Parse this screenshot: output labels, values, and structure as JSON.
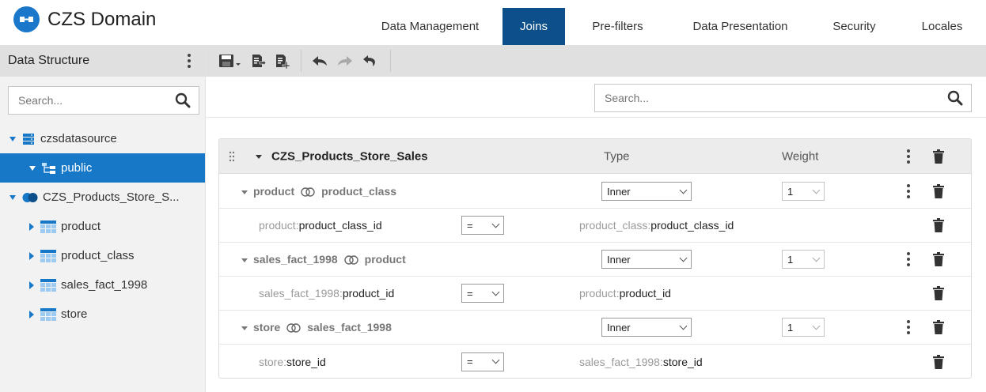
{
  "app": {
    "title": "CZS Domain"
  },
  "tabs": [
    {
      "label": "Data Management",
      "active": false
    },
    {
      "label": "Joins",
      "active": true
    },
    {
      "label": "Pre-filters",
      "active": false
    },
    {
      "label": "Data Presentation",
      "active": false
    },
    {
      "label": "Security",
      "active": false
    },
    {
      "label": "Locales",
      "active": false
    }
  ],
  "sidebar": {
    "title": "Data Structure",
    "search_placeholder": "Search...",
    "tree": [
      {
        "label": "czsdatasource",
        "icon": "server-icon",
        "expanded": true
      },
      {
        "label": "public",
        "icon": "schema-icon",
        "expanded": true,
        "selected": true
      },
      {
        "label": "CZS_Products_Store_S...",
        "icon": "join-icon",
        "expanded": true
      },
      {
        "label": "product",
        "icon": "table-icon",
        "expanded": false
      },
      {
        "label": "product_class",
        "icon": "table-icon",
        "expanded": false
      },
      {
        "label": "sales_fact_1998",
        "icon": "table-icon",
        "expanded": false
      },
      {
        "label": "store",
        "icon": "table-icon",
        "expanded": false
      }
    ]
  },
  "toolbar": {
    "buttons": [
      "save-icon",
      "export-icon",
      "import-icon",
      "undo-icon",
      "redo-icon",
      "undo-all-icon"
    ]
  },
  "main": {
    "search_placeholder": "Search...",
    "join_tree": {
      "name": "CZS_Products_Store_Sales",
      "type_header": "Type",
      "weight_header": "Weight",
      "joins": [
        {
          "left": "product",
          "right": "product_class",
          "type": "Inner",
          "weight": "1",
          "condition": {
            "left_table": "product:",
            "left_field": "product_class_id",
            "operator": "=",
            "right_table": "product_class:",
            "right_field": "product_class_id"
          }
        },
        {
          "left": "sales_fact_1998",
          "right": "product",
          "type": "Inner",
          "weight": "1",
          "condition": {
            "left_table": "sales_fact_1998:",
            "left_field": "product_id",
            "operator": "=",
            "right_table": "product:",
            "right_field": "product_id"
          }
        },
        {
          "left": "store",
          "right": "sales_fact_1998",
          "type": "Inner",
          "weight": "1",
          "condition": {
            "left_table": "store:",
            "left_field": "store_id",
            "operator": "=",
            "right_table": "sales_fact_1998:",
            "right_field": "store_id"
          }
        }
      ]
    }
  },
  "colors": {
    "brand": "#1a77c9",
    "active_tab": "#0d4f8a",
    "selection": "#1778c8",
    "panel_header": "#ececec"
  }
}
